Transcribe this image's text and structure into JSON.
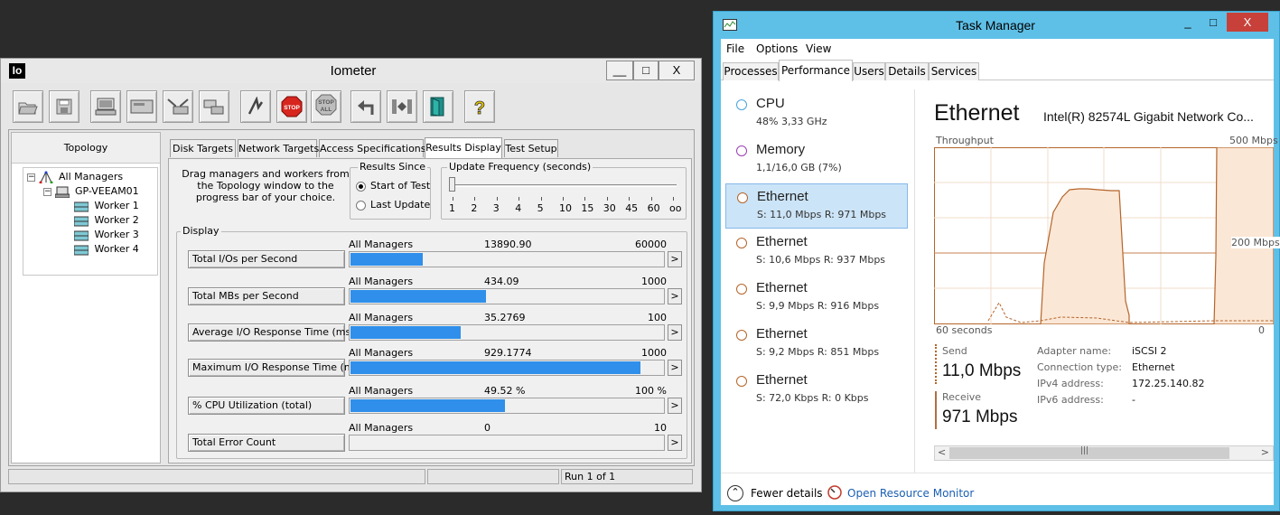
{
  "iometer": {
    "title": "Iometer",
    "logo": "Io",
    "window_buttons": {
      "minimize": "__",
      "maximize": "□",
      "close": "X"
    },
    "toolbar_icons": [
      "open-folder-icon",
      "save-icon",
      "show-display-icon",
      "new-manager-icon",
      "new-disk-worker-icon",
      "new-network-worker-icon",
      "duplicate-worker-icon",
      "start-tests-icon",
      "stop-icon",
      "stop-all-icon",
      "reset-workers-icon",
      "exit-icon",
      "help-icon"
    ],
    "toolbar_labels": {
      "stop": "STOP",
      "stop_all_top": "STOP",
      "stop_all_bottom": "ALL",
      "help": "?"
    },
    "topology": {
      "header": "Topology",
      "root": "All Managers",
      "manager": "GP-VEEAM01",
      "workers": [
        "Worker 1",
        "Worker 2",
        "Worker 3",
        "Worker 4"
      ]
    },
    "tabs": [
      "Disk Targets",
      "Network Targets",
      "Access Specifications",
      "Results Display",
      "Test Setup"
    ],
    "active_tab": "Results Display",
    "drag_text": "Drag managers and workers from the Topology window to the progress bar of your choice.",
    "results_since": {
      "legend": "Results Since",
      "options": [
        "Start of Test",
        "Last Update"
      ],
      "selected": "Start of Test"
    },
    "update_frequency": {
      "legend": "Update Frequency (seconds)",
      "ticks": [
        "1",
        "2",
        "3",
        "4",
        "5",
        "10",
        "15",
        "30",
        "45",
        "60",
        "oo"
      ],
      "selected": "1"
    },
    "display_legend": "Display",
    "metrics": [
      {
        "label": "Total I/Os per Second",
        "manager": "All Managers",
        "value": "13890.90",
        "max": "60000",
        "fraction": 0.2315
      },
      {
        "label": "Total MBs per Second",
        "manager": "All Managers",
        "value": "434.09",
        "max": "1000",
        "fraction": 0.434
      },
      {
        "label": "Average I/O Response Time (ms)",
        "manager": "All Managers",
        "value": "35.2769",
        "max": "100",
        "fraction": 0.3528
      },
      {
        "label": "Maximum I/O Response Time (ms)",
        "manager": "All Managers",
        "value": "929.1774",
        "max": "1000",
        "fraction": 0.929
      },
      {
        "label": "% CPU Utilization (total)",
        "manager": "All Managers",
        "value": "49.52 %",
        "max": "100 %",
        "fraction": 0.4952
      },
      {
        "label": "Total Error Count",
        "manager": "All Managers",
        "value": "0",
        "max": "10",
        "fraction": 0
      }
    ],
    "metric_arrow": ">",
    "status": {
      "run": "Run 1 of 1"
    },
    "colors": {
      "bar": "#2f8fea"
    }
  },
  "task_manager": {
    "title": "Task Manager",
    "window_buttons": {
      "minimize": "_",
      "maximize": "□",
      "close": "X"
    },
    "menu": [
      "File",
      "Options",
      "View"
    ],
    "tabs": [
      "Processes",
      "Performance",
      "Users",
      "Details",
      "Services"
    ],
    "active_tab": "Performance",
    "resources": [
      {
        "name": "CPU",
        "detail": "48% 3,33 GHz",
        "color": "#4aa3df"
      },
      {
        "name": "Memory",
        "detail": "1,1/16,0 GB (7%)",
        "color": "#9b3fb5"
      },
      {
        "name": "Ethernet",
        "detail": "S: 11,0 Mbps R: 971 Mbps",
        "color": "#b5652a",
        "selected": true
      },
      {
        "name": "Ethernet",
        "detail": "S: 10,6 Mbps R: 937 Mbps",
        "color": "#b5652a"
      },
      {
        "name": "Ethernet",
        "detail": "S: 9,9 Mbps R: 916 Mbps",
        "color": "#b5652a"
      },
      {
        "name": "Ethernet",
        "detail": "S: 9,2 Mbps R: 851 Mbps",
        "color": "#b5652a"
      },
      {
        "name": "Ethernet",
        "detail": "S: 72,0 Kbps R: 0 Kbps",
        "color": "#b5652a"
      }
    ],
    "detail": {
      "title": "Ethernet",
      "adapter": "Intel(R) 82574L Gigabit Network Co...",
      "graph_label": "Throughput",
      "graph_max": "500 Mbps",
      "graph_mid": "200 Mbps",
      "graph_time": "60 seconds",
      "graph_min": "0",
      "send_label": "Send",
      "send_value": "11,0 Mbps",
      "receive_label": "Receive",
      "receive_value": "971 Mbps",
      "properties": [
        {
          "key": "Adapter name:",
          "value": "iSCSI 2"
        },
        {
          "key": "Connection type:",
          "value": "Ethernet"
        },
        {
          "key": "IPv4 address:",
          "value": "172.25.140.82"
        },
        {
          "key": "IPv6 address:",
          "value": "-"
        }
      ]
    },
    "scroll": {
      "left": "<",
      "right": ">",
      "grip": "|||"
    },
    "footer": {
      "fewer_details": "Fewer details",
      "open_resource_monitor": "Open Resource Monitor"
    },
    "colors": {
      "ethernet": "#b5652a",
      "graph_fill": "#fbeee2",
      "titlebar": "#5fc0e7",
      "close": "#c7413a"
    }
  }
}
